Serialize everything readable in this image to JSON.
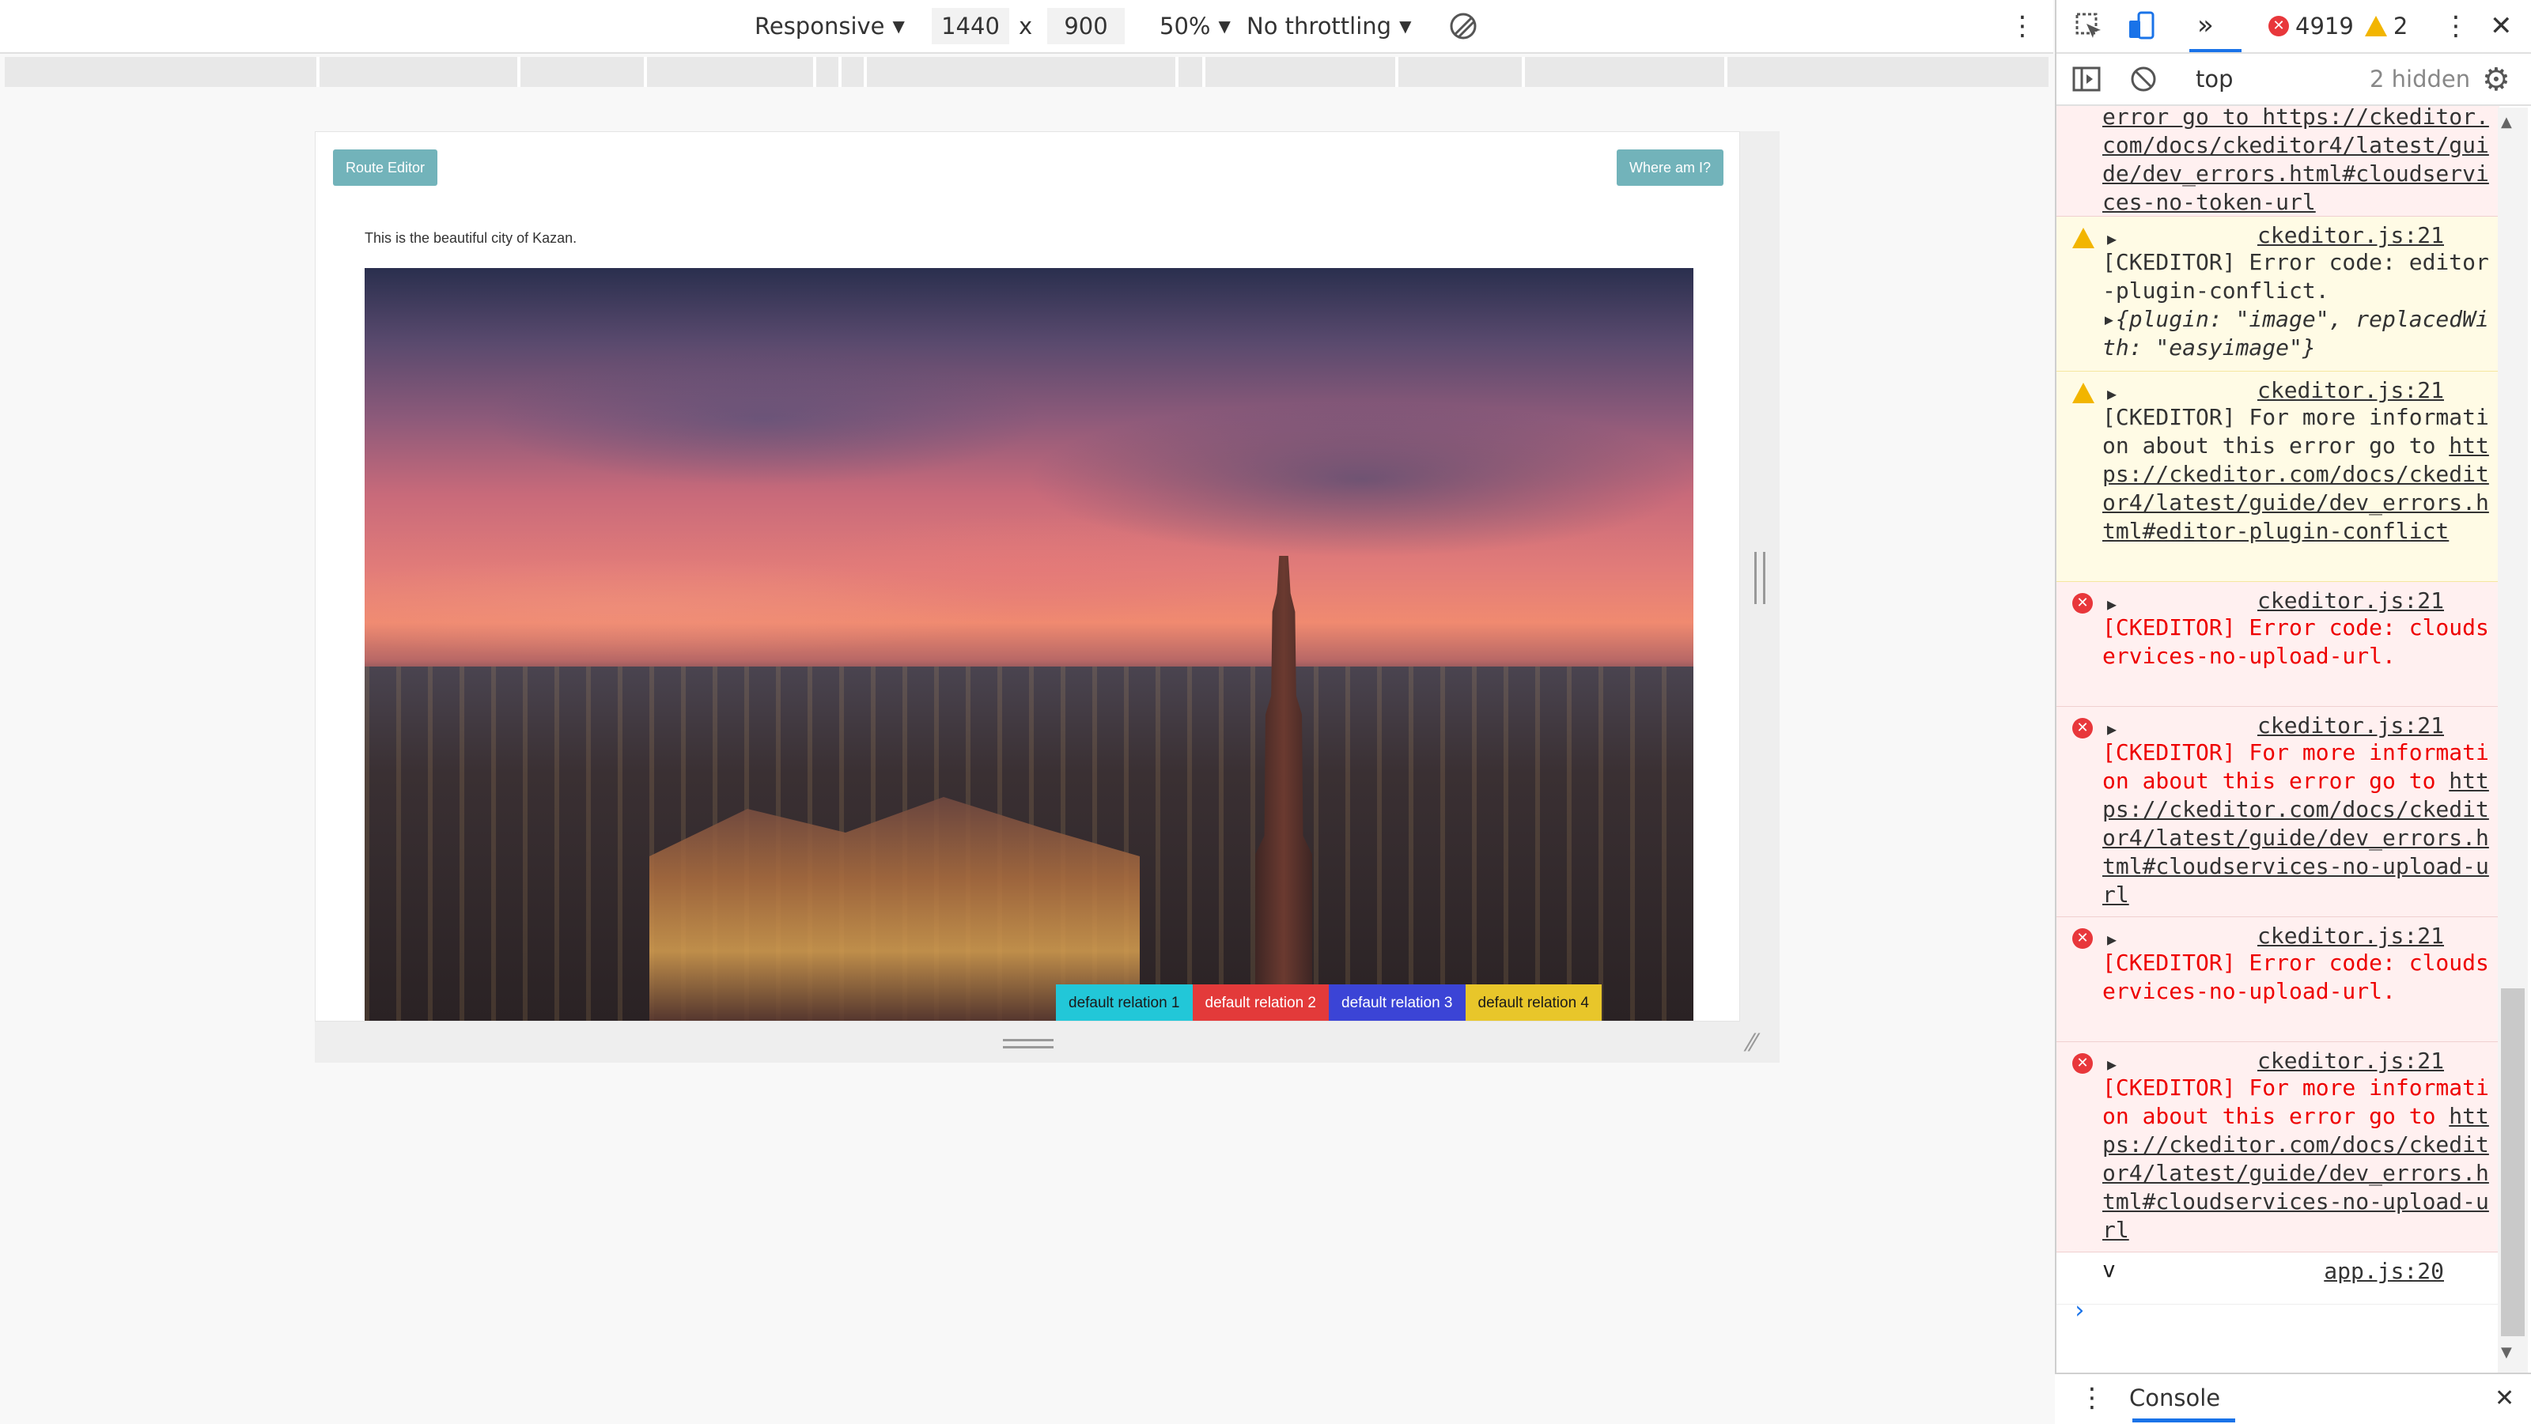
{
  "device_toolbar": {
    "device": "Responsive",
    "width": "1440",
    "times": "x",
    "height": "900",
    "zoom": "50%",
    "throttling": "No throttling"
  },
  "page": {
    "route_editor": "Route Editor",
    "where_am_i": "Where am I?",
    "intro": "This is the beautiful city of Kazan.",
    "relations": [
      {
        "label": "default relation 1",
        "color": "#22c7d8",
        "text_color": "#1a1a1a"
      },
      {
        "label": "default relation 2",
        "color": "#e33a3a",
        "text_color": "#ffffff"
      },
      {
        "label": "default relation 3",
        "color": "#3b44d6",
        "text_color": "#ffffff"
      },
      {
        "label": "default relation 4",
        "color": "#e8c62a",
        "text_color": "#1a1a1a"
      }
    ]
  },
  "devtools": {
    "more_tabs": "»",
    "error_count": "4919",
    "warning_count": "2",
    "context": "top",
    "hidden": "2 hidden",
    "messages": [
      {
        "level": "error",
        "source": "",
        "text_prefix": "",
        "link": "error go to https://ckeditor.com/docs/ckeditor4/latest/guide/dev_errors.html#cloudservices-no-token-url"
      },
      {
        "level": "warning",
        "source": "ckeditor.js:21",
        "text_prefix": "[CKEDITOR] Error code: editor-plugin-conflict.",
        "object": "{plugin: \"image\", replacedWith: \"easyimage\"}"
      },
      {
        "level": "warning",
        "source": "ckeditor.js:21",
        "text_prefix": "[CKEDITOR] For more information about this error go to ",
        "link": "https://ckeditor.com/docs/ckeditor4/latest/guide/dev_errors.html#editor-plugin-conflict"
      },
      {
        "level": "error",
        "source": "ckeditor.js:21",
        "text_prefix": "[CKEDITOR] Error code: cloudservices-no-upload-url."
      },
      {
        "level": "error",
        "source": "ckeditor.js:21",
        "text_prefix": "[CKEDITOR] For more information about this error go to ",
        "link": "https://ckeditor.com/docs/ckeditor4/latest/guide/dev_errors.html#cloudservices-no-upload-url"
      },
      {
        "level": "error",
        "source": "ckeditor.js:21",
        "text_prefix": "[CKEDITOR] Error code: cloudservices-no-upload-url."
      },
      {
        "level": "error",
        "source": "ckeditor.js:21",
        "text_prefix": "[CKEDITOR] For more information about this error go to ",
        "link": "https://ckeditor.com/docs/ckeditor4/latest/guide/dev_errors.html#cloudservices-no-upload-url"
      },
      {
        "level": "log",
        "source": "app.js:20",
        "text_prefix": "v"
      }
    ],
    "drawer_tab": "Console"
  }
}
